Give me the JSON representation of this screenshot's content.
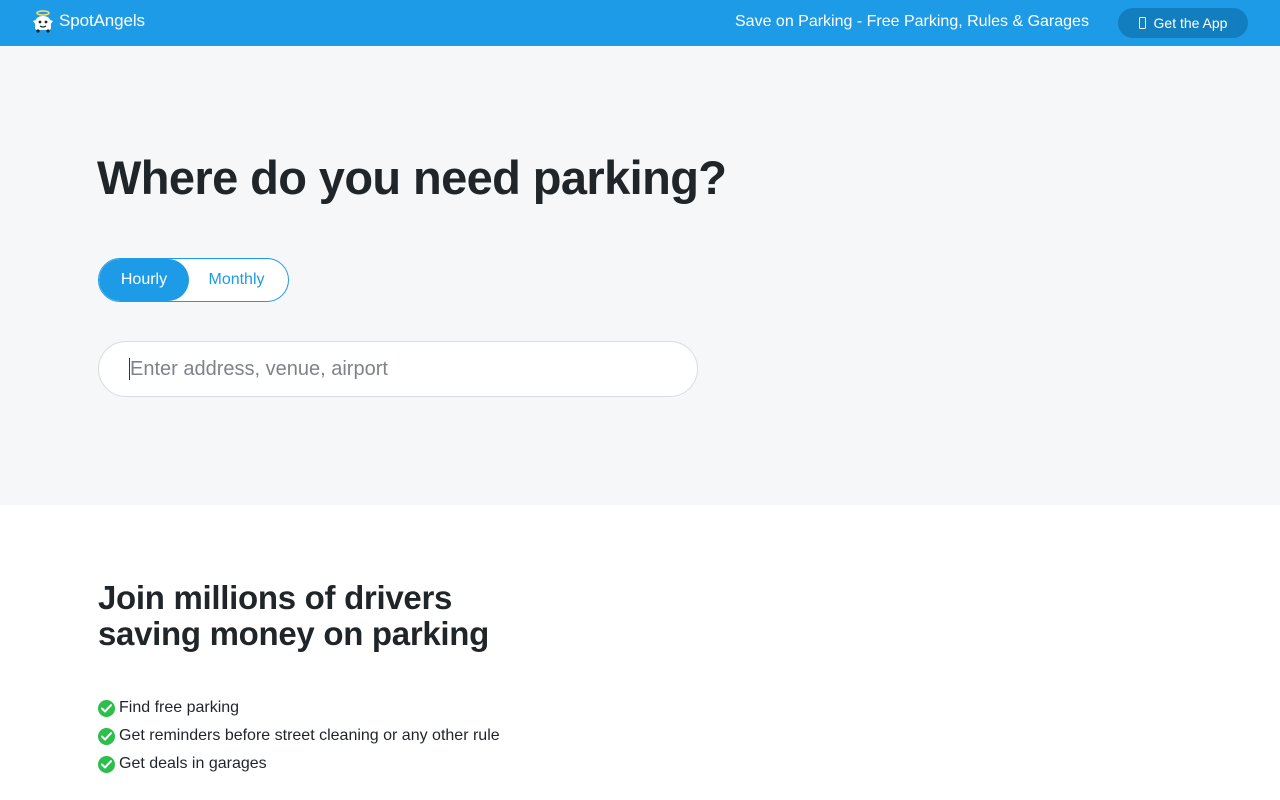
{
  "header": {
    "brand": "SpotAngels",
    "tagline": "Save on Parking - Free Parking, Rules & Garages",
    "get_app_label": "Get the App",
    "brand_color": "#1e9be6"
  },
  "hero": {
    "title": "Where do you need parking?",
    "toggle": {
      "options": [
        "Hourly",
        "Monthly"
      ],
      "selected": "Hourly"
    },
    "search": {
      "value": "",
      "placeholder": "Enter address, venue, airport"
    }
  },
  "join": {
    "title_line1": "Join millions of drivers",
    "title_line2": "saving money on parking",
    "benefits": [
      "Find free parking",
      "Get reminders before street cleaning or any other rule",
      "Get deals in garages"
    ],
    "check_color": "#2dbf4b"
  },
  "icons": {
    "logo": "angel-car-logo-icon",
    "phone": "phone-icon",
    "check": "check-circle-icon"
  }
}
